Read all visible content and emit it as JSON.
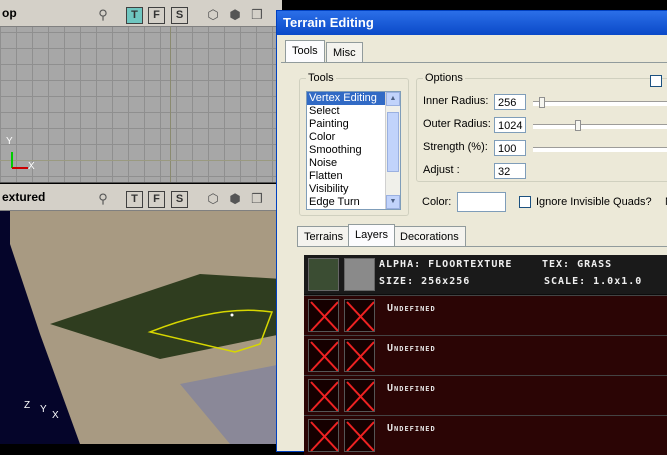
{
  "viewport_top": {
    "title": "op",
    "buttons": [
      "T",
      "F",
      "S"
    ],
    "active_button": "T",
    "icons": [
      "person-icon",
      "cube-view-icon",
      "cube-shaded-icon",
      "cube-solid-icon"
    ],
    "axes": {
      "y": "Y",
      "x": "X"
    }
  },
  "viewport_3d": {
    "title": "extured",
    "buttons": [
      "T",
      "F",
      "S"
    ],
    "icons": [
      "person-icon",
      "cube-view-icon",
      "cube-shaded-icon",
      "cube-solid-icon"
    ],
    "axes": {
      "z": "Z",
      "y": "Y",
      "x": "X"
    }
  },
  "window": {
    "title": "Terrain Editing",
    "tabs": [
      "Tools",
      "Misc"
    ],
    "active_tab": "Tools",
    "tools_group": {
      "label": "Tools",
      "items": [
        "Vertex Editing",
        "Select",
        "Painting",
        "Color",
        "Smoothing",
        "Noise",
        "Flatten",
        "Visibility",
        "Edge Turn"
      ],
      "selected": "Vertex Editing"
    },
    "options_group": {
      "label": "Options",
      "inner_radius_label": "Inner Radius:",
      "inner_radius_value": "256",
      "inner_radius_slider": 0.04,
      "outer_radius_label": "Outer Radius:",
      "outer_radius_value": "1024",
      "outer_radius_slider": 0.3,
      "strength_label": "Strength (%):",
      "strength_value": "100",
      "adjust_label": "Adjust :",
      "adjust_value": "32"
    },
    "color_label": "Color:",
    "color_value": "#ffffff",
    "ignore_invisible_label": "Ignore Invisible Quads?",
    "ignore_invisible_checked": false,
    "trailing_text": "N",
    "subtabs": [
      "Terrains",
      "Layers",
      "Decorations"
    ],
    "active_subtab": "Layers",
    "layer_info": {
      "alpha": "ALPHA: FLOORTEXTURE",
      "tex": "TEX: GRASS",
      "size": "SIZE: 256x256",
      "scale": "SCALE: 1.0x1.0"
    },
    "layers": [
      "Undefined",
      "Undefined",
      "Undefined",
      "Undefined"
    ]
  }
}
